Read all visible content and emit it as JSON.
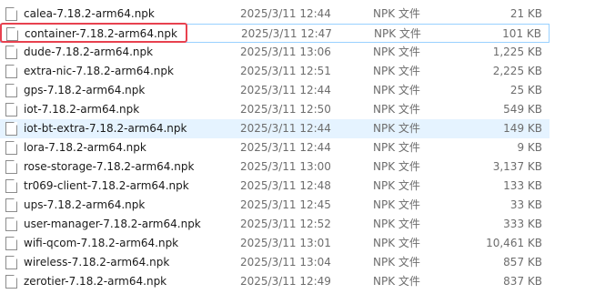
{
  "files": [
    {
      "name": "calea-7.18.2-arm64.npk",
      "date": "2025/3/11 12:44",
      "type": "NPK 文件",
      "size": "21 KB"
    },
    {
      "name": "container-7.18.2-arm64.npk",
      "date": "2025/3/11 12:47",
      "type": "NPK 文件",
      "size": "101 KB"
    },
    {
      "name": "dude-7.18.2-arm64.npk",
      "date": "2025/3/11 13:06",
      "type": "NPK 文件",
      "size": "1,225 KB"
    },
    {
      "name": "extra-nic-7.18.2-arm64.npk",
      "date": "2025/3/11 12:51",
      "type": "NPK 文件",
      "size": "2,225 KB"
    },
    {
      "name": "gps-7.18.2-arm64.npk",
      "date": "2025/3/11 12:44",
      "type": "NPK 文件",
      "size": "25 KB"
    },
    {
      "name": "iot-7.18.2-arm64.npk",
      "date": "2025/3/11 12:50",
      "type": "NPK 文件",
      "size": "549 KB"
    },
    {
      "name": "iot-bt-extra-7.18.2-arm64.npk",
      "date": "2025/3/11 12:44",
      "type": "NPK 文件",
      "size": "149 KB"
    },
    {
      "name": "lora-7.18.2-arm64.npk",
      "date": "2025/3/11 12:44",
      "type": "NPK 文件",
      "size": "9 KB"
    },
    {
      "name": "rose-storage-7.18.2-arm64.npk",
      "date": "2025/3/11 13:00",
      "type": "NPK 文件",
      "size": "3,137 KB"
    },
    {
      "name": "tr069-client-7.18.2-arm64.npk",
      "date": "2025/3/11 12:48",
      "type": "NPK 文件",
      "size": "133 KB"
    },
    {
      "name": "ups-7.18.2-arm64.npk",
      "date": "2025/3/11 12:45",
      "type": "NPK 文件",
      "size": "33 KB"
    },
    {
      "name": "user-manager-7.18.2-arm64.npk",
      "date": "2025/3/11 12:52",
      "type": "NPK 文件",
      "size": "333 KB"
    },
    {
      "name": "wifi-qcom-7.18.2-arm64.npk",
      "date": "2025/3/11 13:01",
      "type": "NPK 文件",
      "size": "10,461 KB"
    },
    {
      "name": "wireless-7.18.2-arm64.npk",
      "date": "2025/3/11 13:04",
      "type": "NPK 文件",
      "size": "857 KB"
    },
    {
      "name": "zerotier-7.18.2-arm64.npk",
      "date": "2025/3/11 12:49",
      "type": "NPK 文件",
      "size": "837 KB"
    }
  ],
  "colors": {
    "highlight_box": "#e8414f",
    "hover_row": "#e5f3ff",
    "selected_border": "#99d1ff",
    "secondary_text": "#6d6d6d"
  },
  "icons": {
    "file": "generic-file-icon"
  }
}
